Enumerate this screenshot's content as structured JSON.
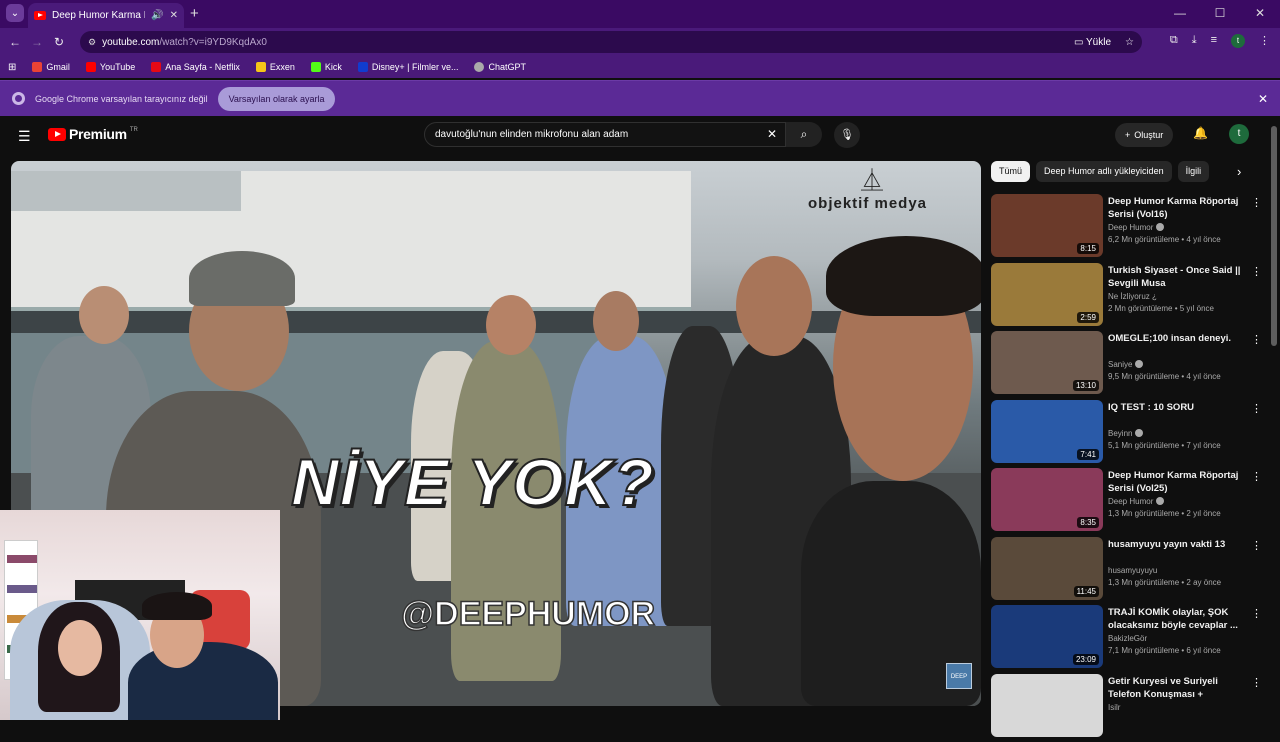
{
  "browser": {
    "tab_title": "Deep Humor Karma Röportaj",
    "url_host": "youtube.com",
    "url_path": "/watch?v=i9YD9KqdAx0",
    "share_label": "Yükle",
    "bookmarks": [
      "Gmail",
      "YouTube",
      "Ana Sayfa - Netflix",
      "Exxen",
      "Kick",
      "Disney+ | Filmler ve...",
      "ChatGPT"
    ],
    "bookmark_colors": [
      "#ea4335",
      "#ff0000",
      "#e50914",
      "#f5c518",
      "#53fc18",
      "#113ccf",
      "#aaaaaa"
    ],
    "infobar_text": "Google Chrome varsayılan tarayıcınız değil",
    "infobar_button": "Varsayılan olarak ayarla",
    "profile_letter": "t"
  },
  "youtube": {
    "logo_text": "Premium",
    "logo_superscript": "TR",
    "search_value": "davutoğlu'nun elinden mikrofonu alan adam",
    "create_label": "Oluştur",
    "user_letter": "t"
  },
  "video": {
    "caption": "NİYE YOK?",
    "handle": "@DEEPHUMOR",
    "watermark": "objektif medya"
  },
  "chips": [
    "Tümü",
    "Deep Humor adlı yükleyiciden",
    "İlgili"
  ],
  "recommendations": [
    {
      "title": "Deep Humor Karma Röportaj Serisi (Vol16)",
      "channel": "Deep Humor",
      "verified": true,
      "meta": "6,2 Mn görüntüleme • 4 yıl önce",
      "duration": "8:15",
      "thumb": "#6b3a2a"
    },
    {
      "title": "Turkish Siyaset - Once Said || Sevgili Musa",
      "channel": "Ne İzliyoruz ¿",
      "verified": false,
      "meta": "2 Mn görüntüleme • 5 yıl önce",
      "duration": "2:59",
      "thumb": "#9a7a3a"
    },
    {
      "title": "OMEGLE;100 insan deneyi.",
      "channel": "Saniye",
      "verified": true,
      "meta": "9,5 Mn görüntüleme • 4 yıl önce",
      "duration": "13:10",
      "thumb": "#6e5a4e"
    },
    {
      "title": "IQ TEST : 10 SORU",
      "channel": "Beyinn",
      "verified": true,
      "meta": "5,1 Mn görüntüleme • 7 yıl önce",
      "duration": "7:41",
      "thumb": "#2a5aa8"
    },
    {
      "title": "Deep Humor Karma Röportaj Serisi (Vol25)",
      "channel": "Deep Humor",
      "verified": true,
      "meta": "1,3 Mn görüntüleme • 2 yıl önce",
      "duration": "8:35",
      "thumb": "#8a3a5a"
    },
    {
      "title": "husamyuyu yayın vakti 13",
      "channel": "husamyuyuyu",
      "verified": false,
      "meta": "1,3 Mn görüntüleme • 2 ay önce",
      "duration": "11:45",
      "thumb": "#5a4a3a"
    },
    {
      "title": "TRAJİ KOMİK olaylar, ŞOK olacaksınız böyle cevaplar ...",
      "channel": "BakizleGör",
      "verified": false,
      "meta": "7,1 Mn görüntüleme • 6 yıl önce",
      "duration": "23:09",
      "thumb": "#1a3a7a"
    },
    {
      "title": "Getir Kuryesi ve Suriyeli Telefon Konuşması + whatsapp (uzun ...",
      "channel": "Isilr",
      "verified": false,
      "meta": "",
      "duration": "",
      "thumb": "#d8d8d8"
    }
  ]
}
